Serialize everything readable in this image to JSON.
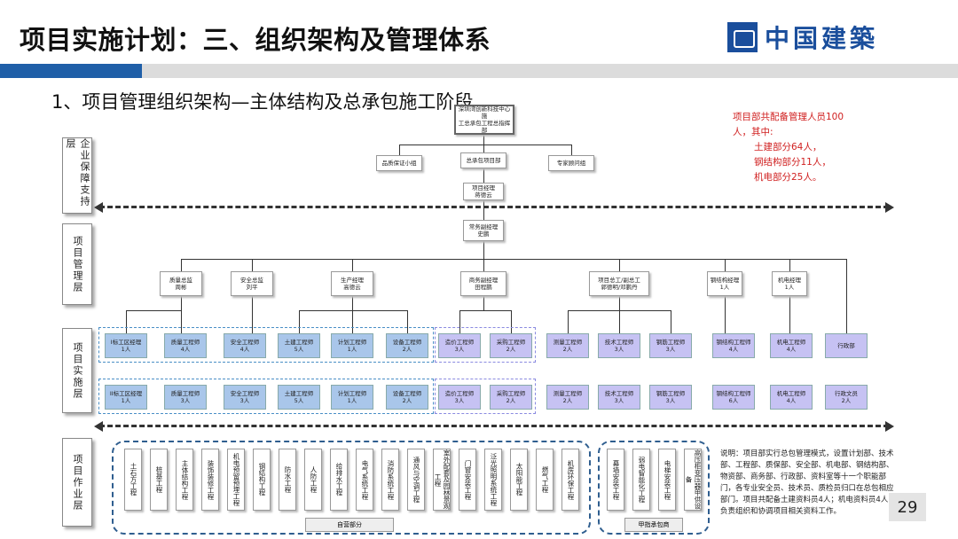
{
  "header": {
    "title": "项目实施计划：三、组织架构及管理体系",
    "logo_text": "中国建築",
    "subtitle": "1、项目管理组织架构—主体结构及总承包施工阶段"
  },
  "note_red": [
    "项目部共配备管理人员100",
    "人，其中:",
    "土建部分64人，",
    "钢结构部分11人，",
    "机电部分25人。"
  ],
  "layers": {
    "l1": "企业保障支持层",
    "l2": "项目管理层",
    "l3": "项目实施层",
    "l4": "项目作业层"
  },
  "org": {
    "top": [
      "深圳湾创新科技中心施",
      "工总承包工程总指挥部"
    ],
    "quality": "品质保证小组",
    "general": "总承包项目部",
    "expert": "专家顾问组",
    "pm": [
      "项目经理",
      "蒋德云"
    ],
    "exec": [
      "常务副经理",
      "史鹏"
    ],
    "m1": [
      "质量总监",
      "周彬"
    ],
    "m2": [
      "安全总监",
      "刘平"
    ],
    "m3": [
      "生产经理",
      "高德云"
    ],
    "m4": [
      "商务副经理",
      "田程鹏"
    ],
    "m5": [
      "项目总工/副总工",
      "郭德明/邓鹏丹"
    ],
    "m6": [
      "钢结构经理",
      "1人"
    ],
    "m7": [
      "机电经理",
      "1人"
    ]
  },
  "row1": [
    [
      "I标工区经理",
      "1人"
    ],
    [
      "质量工程师",
      "4人"
    ],
    [
      "安全工程师",
      "4人"
    ],
    [
      "土建工程师",
      "5人"
    ],
    [
      "计划工程师",
      "1人"
    ],
    [
      "设备工程师",
      "2人"
    ],
    [
      "造价工程师",
      "3人"
    ],
    [
      "采购工程师",
      "2人"
    ],
    [
      "测量工程师",
      "2人"
    ],
    [
      "技术工程师",
      "3人"
    ],
    [
      "钢筋工程师",
      "3人"
    ],
    [
      "钢结构工程师",
      "4人"
    ],
    [
      "机电工程师",
      "4人"
    ],
    [
      "行政部",
      ""
    ]
  ],
  "row2": [
    [
      "II标工区经理",
      "1人"
    ],
    [
      "质量工程师",
      "3人"
    ],
    [
      "安全工程师",
      "3人"
    ],
    [
      "土建工程师",
      "5人"
    ],
    [
      "计划工程师",
      "1人"
    ],
    [
      "设备工程师",
      "2人"
    ],
    [
      "造价工程师",
      "3人"
    ],
    [
      "采购工程师",
      "2人"
    ],
    [
      "测量工程师",
      "2人"
    ],
    [
      "技术工程师",
      "3人"
    ],
    [
      "钢筋工程师",
      "3人"
    ],
    [
      "钢结构工程师",
      "6人"
    ],
    [
      "机电工程师",
      "4人"
    ],
    [
      "行政文员",
      "2人"
    ]
  ],
  "work_self": [
    "土石方工程",
    "桩基工程",
    "主体结构工程",
    "装饰装修工程",
    "机电预留预埋工程",
    "钢结构工程",
    "防水工程",
    "人防工程",
    "给排水工程",
    "电气系统工程",
    "消防系统工程",
    "通风与空调工程",
    "室外配套及园林景观工程",
    "门窗安装工程",
    "泛光照明系统工程",
    "太阳能工程",
    "燃气工程",
    "机房环保工程"
  ],
  "work_owner": [
    "幕墙安装工程",
    "弱电智能化工程",
    "电梯安装工程",
    "高压柜变压器甲供设备"
  ],
  "group_self": "自营部分",
  "group_owner": "甲指承包商",
  "explanation": "说明：项目部实行总包管理模式，设置计划部、技术部、工程部、质保部、安全部、机电部、钢结构部、物资部、商务部、行政部、资料室等十一个职能部门，各专业安全员、技术员、质检员归口在总包相应部门。项目共配备土建资料员4人；机电资料员4人，负责组织和协调项目相关资料工作。",
  "page": "29"
}
